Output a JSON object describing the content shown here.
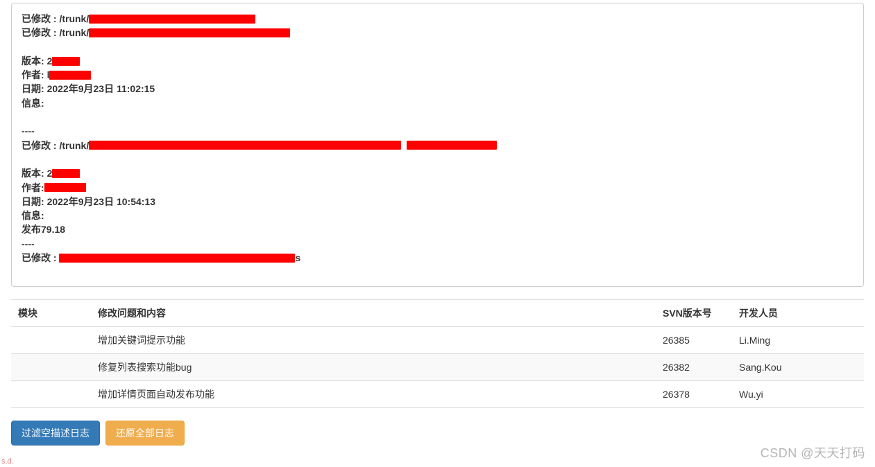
{
  "log": {
    "entries": [
      {
        "modified_label": "已修改 :",
        "path_prefix": "/trunk/",
        "path_suffix": ""
      },
      {
        "modified_label": "已修改 :",
        "path_prefix": "/trunk/",
        "path_suffix": ""
      }
    ],
    "section1": {
      "version_label": "版本:",
      "version_prefix": "2",
      "author_label": "作者:",
      "author_prefix": "l",
      "date_label": "日期:",
      "date_value": "2022年9月23日 11:02:15",
      "info_label": "信息:",
      "separator": "----",
      "modified_label": "已修改 :",
      "path_prefix": "/trunk/"
    },
    "section2": {
      "version_label": "版本:",
      "version_prefix": "2",
      "author_label": "作者:",
      "author_prefix": "",
      "date_label": "日期:",
      "date_value": "2022年9月23日 10:54:13",
      "info_label": "信息:",
      "release": "发布79.18",
      "separator": "----",
      "modified_label": "已修改 :",
      "path_suffix": "s"
    }
  },
  "table": {
    "headers": {
      "module": "模块",
      "content": "修改问题和内容",
      "svn": "SVN版本号",
      "dev": "开发人员"
    },
    "rows": [
      {
        "module": "",
        "content": "增加关键词提示功能",
        "svn": "26385",
        "dev": "Li.Ming"
      },
      {
        "module": "",
        "content": "修复列表搜索功能bug",
        "svn": "26382",
        "dev": "Sang.Kou"
      },
      {
        "module": "",
        "content": "增加详情页面自动发布功能",
        "svn": "26378",
        "dev": "Wu.yi"
      }
    ]
  },
  "buttons": {
    "filter": "过滤空描述日志",
    "restore": "还原全部日志"
  },
  "bottom_hint": "s.d.",
  "watermark": "CSDN @天天打码"
}
